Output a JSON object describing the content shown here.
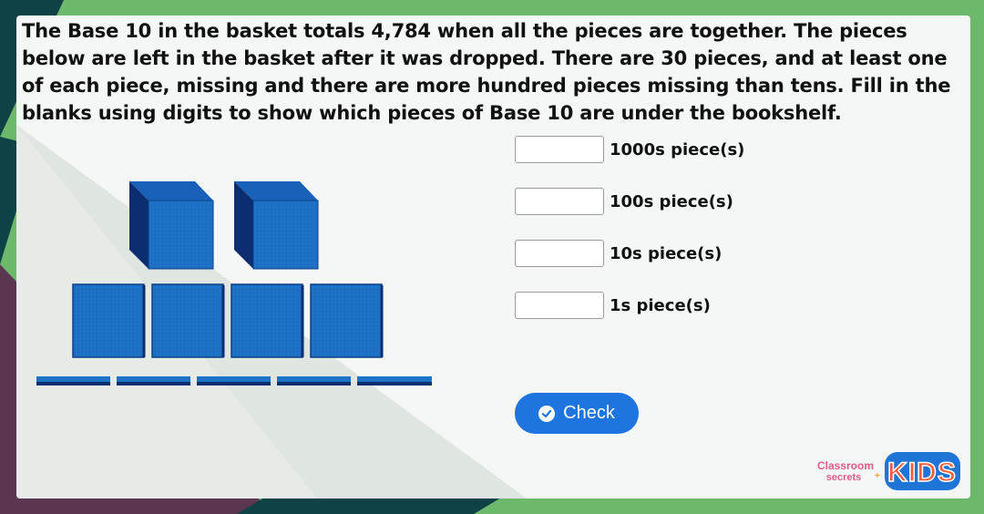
{
  "question": {
    "text": "The Base 10 in the basket totals 4,784 when all the pieces are together. The pieces below are left in the basket after it was dropped. There are 30 pieces, and at least one of each piece, missing and there are more hundred pieces missing than tens. Fill in the blanks using digits to show which pieces of Base 10 are under the bookshelf."
  },
  "blocks": {
    "thousands_shown": 2,
    "hundreds_shown": 4,
    "tens_shown": 5,
    "ones_shown": 0
  },
  "answers": [
    {
      "label": "1000s piece(s)",
      "value": ""
    },
    {
      "label": "100s piece(s)",
      "value": ""
    },
    {
      "label": "10s piece(s)",
      "value": ""
    },
    {
      "label": "1s piece(s)",
      "value": ""
    }
  ],
  "check_button": {
    "label": "Check",
    "icon": "check-circle-icon"
  },
  "logo": {
    "line1": "Classroom",
    "line2": "secrets",
    "kids": "KIDS"
  },
  "colors": {
    "frame_green": "#6db86a",
    "frame_teal": "#0f4246",
    "frame_maroon": "#5a3650",
    "block_blue": "#1e73c8",
    "block_dark": "#0d3f86",
    "button_blue": "#1f75e0"
  }
}
